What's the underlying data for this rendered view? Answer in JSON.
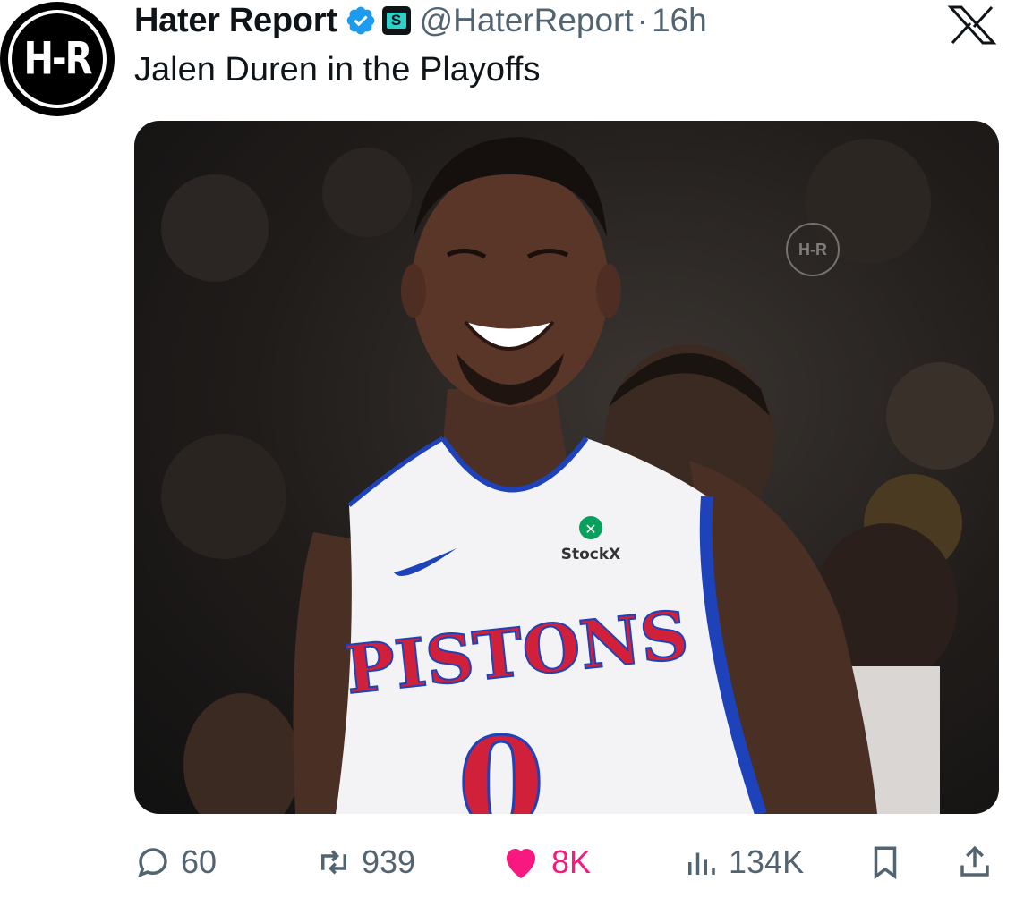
{
  "tweet": {
    "avatar": {
      "icon": "hater-report-logo-icon",
      "text": "H-R"
    },
    "display_name": "Hater Report",
    "handle": "@HaterReport",
    "separator": "·",
    "time": "16h",
    "verified_icon": "verified-badge-icon",
    "affiliate_icon": "affiliate-badge-icon",
    "affiliate_letter": "S",
    "platform_icon": "x-logo-icon",
    "text": "Jalen Duren in the Playoffs",
    "media": {
      "watermark": "H-R",
      "jersey_sponsor": "StockX",
      "jersey_team": "PISTONS",
      "jersey_number": "0"
    },
    "actions": {
      "replies": {
        "icon": "reply-icon",
        "count": "60"
      },
      "reposts": {
        "icon": "repost-icon",
        "count": "939"
      },
      "likes": {
        "icon": "heart-icon",
        "count": "8K",
        "color": "#f91880"
      },
      "views": {
        "icon": "views-chart-icon",
        "count": "134K"
      },
      "bookmark": {
        "icon": "bookmark-icon"
      },
      "share": {
        "icon": "share-icon"
      }
    }
  }
}
